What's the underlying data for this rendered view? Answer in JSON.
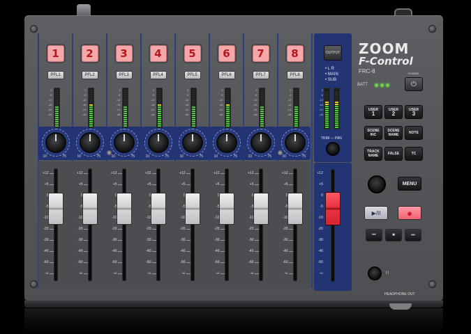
{
  "device": {
    "brand": "ZOOM",
    "product": "F-Control",
    "model": "FRC-8",
    "batt_label": "BATT",
    "power_label": "POWER",
    "power_symbol": "⏻",
    "headphone_label": "HEADPHONE OUT",
    "headphone_icon": "headphone-icon",
    "headphone_glyph": "🎧"
  },
  "channels": [
    {
      "number": "1",
      "pfl": "PFL1"
    },
    {
      "number": "2",
      "pfl": "PFL2"
    },
    {
      "number": "3",
      "pfl": "PFL3"
    },
    {
      "number": "4",
      "pfl": "PFL4"
    },
    {
      "number": "5",
      "pfl": "PFL5"
    },
    {
      "number": "6",
      "pfl": "PFL6"
    },
    {
      "number": "7",
      "pfl": "PFL7"
    },
    {
      "number": "8",
      "pfl": "PFL8"
    }
  ],
  "meter_scale": [
    "0",
    "-6",
    "-12",
    "-18",
    "-24",
    "-48"
  ],
  "knob_labels": {
    "min": "10",
    "max": "75"
  },
  "fader_scale": [
    "+12",
    "+5",
    "0",
    "-5",
    "-10",
    "-20",
    "-30",
    "-40",
    "-60",
    "-∞"
  ],
  "output": {
    "button": "OUTPUT",
    "lr": "L R",
    "main": "MAIN",
    "sub": "SUB",
    "trim_pan": "TRIM — PAN"
  },
  "user_buttons": [
    {
      "top": "USER",
      "bottom": "1"
    },
    {
      "top": "USER",
      "bottom": "2"
    },
    {
      "top": "USER",
      "bottom": "3"
    }
  ],
  "function_buttons": [
    {
      "top": "SCENE",
      "bottom": "INC"
    },
    {
      "top": "SCENE",
      "bottom": "NAME"
    },
    {
      "top": "NOTE",
      "bottom": ""
    },
    {
      "top": "TRACK",
      "bottom": "NAME"
    },
    {
      "top": "FALSE",
      "bottom": ""
    },
    {
      "top": "TC",
      "bottom": ""
    }
  ],
  "menu": "MENU",
  "transport": {
    "play": "▶/II",
    "rec": "●",
    "rew": "⏮",
    "stop": "■",
    "ff": "⏭"
  },
  "colors": {
    "channel_button": "#f4a7a8",
    "channel_text": "#b1161c",
    "panel_blue": "#223473",
    "meter_green": "#4ccf3b",
    "meter_yellow": "#e3d23a",
    "master_fader": "#e8333f",
    "batt_led": "#6ad34a"
  },
  "meter_levels": [
    0.55,
    0.62,
    0.55,
    0.6,
    0.58,
    0.6,
    0.57,
    0.55
  ],
  "master_meter_levels": [
    0.72,
    0.72
  ]
}
